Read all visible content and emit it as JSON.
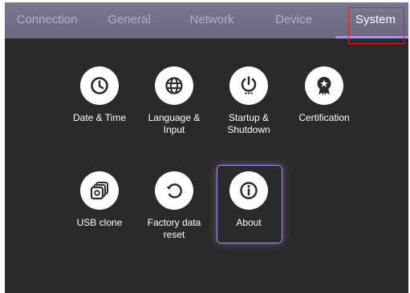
{
  "tabs": [
    {
      "label": "Connection"
    },
    {
      "label": "General"
    },
    {
      "label": "Network"
    },
    {
      "label": "Device"
    },
    {
      "label": "System",
      "active": true
    }
  ],
  "items": [
    {
      "label": "Date & Time",
      "icon": "clock-icon"
    },
    {
      "label": "Language &\nInput",
      "icon": "globe-icon"
    },
    {
      "label": "Startup &\nShutdown",
      "icon": "power-icon"
    },
    {
      "label": "Certification",
      "icon": "certification-badge-icon"
    },
    {
      "label": "USB clone",
      "icon": "usb-clone-icon"
    },
    {
      "label": "Factory data\nreset",
      "icon": "reset-icon"
    },
    {
      "label": "About",
      "icon": "info-icon",
      "selected": true
    }
  ],
  "colors": {
    "background": "#2b2a2b",
    "tabbar": "#7b7691",
    "accent": "#b38cf0",
    "highlight": "#e02020"
  }
}
